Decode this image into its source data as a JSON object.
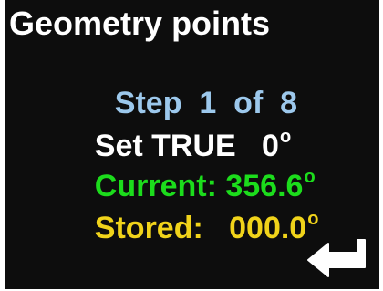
{
  "title": "Geometry points",
  "step": {
    "text": "Step  1  of  8",
    "color": "#9cc8ec"
  },
  "set_true": {
    "label": "Set TRUE   0",
    "degree": "o",
    "color": "#ffffff"
  },
  "current": {
    "label": "Current: 356.6",
    "degree": "o",
    "color": "#1cdc1c"
  },
  "stored": {
    "label": "Stored:   000.0",
    "degree": "o",
    "color": "#f0d31a"
  },
  "enter_button": {
    "icon": "enter-return-icon",
    "color": "#ffffff"
  },
  "screen_background": "#0d0d0d"
}
